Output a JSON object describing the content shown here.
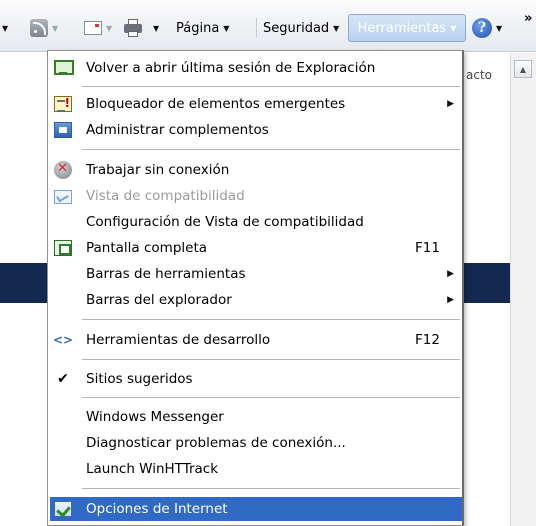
{
  "toolbar": {
    "pagina_label": "Página",
    "seguridad_label": "Seguridad",
    "herramientas_label": "Herramientas",
    "overflow": "»"
  },
  "background": {
    "right_text": "acto"
  },
  "menu": {
    "items": [
      {
        "label": "Volver a abrir última sesión de Exploración",
        "icon": "reopen-session-icon"
      },
      {
        "label": "Bloqueador de elementos emergentes",
        "icon": "popup-blocker-icon",
        "submenu": true
      },
      {
        "label": "Administrar complementos",
        "icon": "addons-icon"
      },
      {
        "label": "Trabajar sin conexión",
        "icon": "offline-icon"
      },
      {
        "label": "Vista de compatibilidad",
        "icon": "compat-view-icon",
        "disabled": true
      },
      {
        "label": "Configuración de Vista de compatibilidad"
      },
      {
        "label": "Pantalla completa",
        "icon": "fullscreen-icon",
        "shortcut": "F11"
      },
      {
        "label": "Barras de herramientas",
        "submenu": true
      },
      {
        "label": "Barras del explorador",
        "submenu": true
      },
      {
        "label": "Herramientas de desarrollo",
        "icon": "dev-tools-icon",
        "shortcut": "F12"
      },
      {
        "label": "Sitios sugeridos",
        "checked": true
      },
      {
        "label": "Windows Messenger"
      },
      {
        "label": "Diagnosticar problemas de conexión..."
      },
      {
        "label": "Launch WinHTTrack"
      },
      {
        "label": "Opciones de Internet",
        "icon": "internet-options-icon",
        "selected": true
      }
    ]
  },
  "colors": {
    "selection": "#316ac5",
    "banner": "#13294f",
    "herramientas_button": "#c5daf2"
  }
}
